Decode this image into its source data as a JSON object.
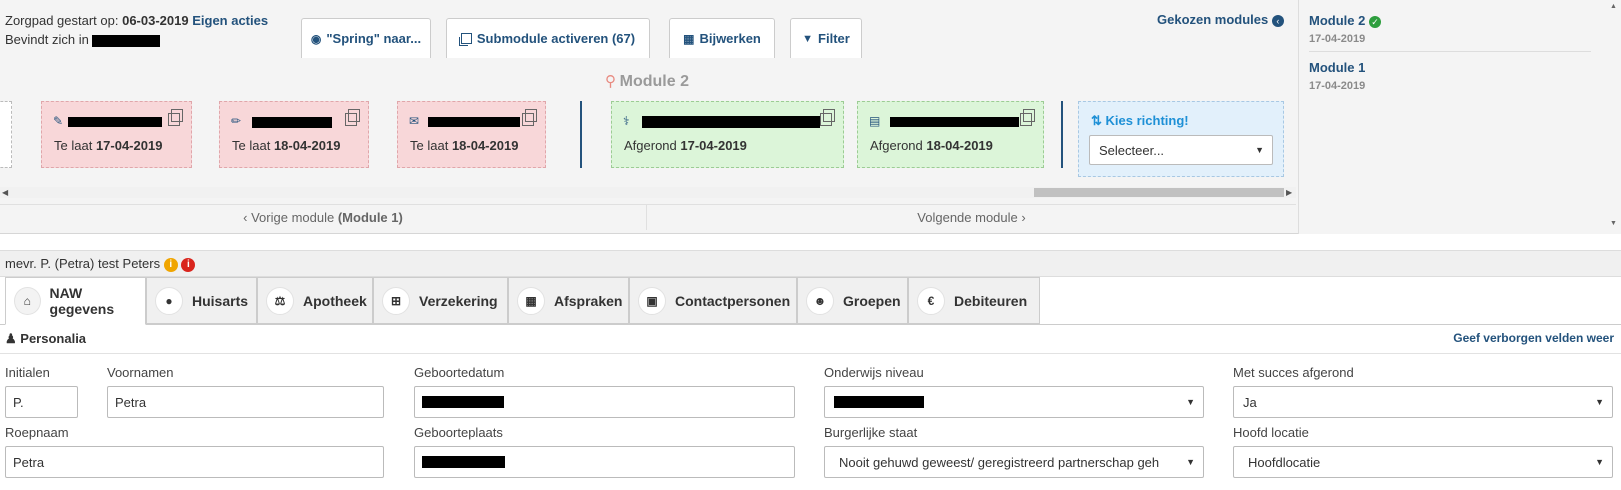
{
  "pathway": {
    "started_label": "Zorgpad gestart op:",
    "started_date": "06-03-2019",
    "own_actions": "Eigen acties",
    "located_in": "Bevindt zich in"
  },
  "toolbar": {
    "jump_label": "\"Spring\" naar...",
    "activate_label": "Submodule activeren (67)",
    "update_label": "Bijwerken",
    "filter_label": "Filter",
    "chosen_modules_label": "Gekozen modules"
  },
  "module": {
    "title": "Module 2",
    "cards": [
      {
        "status": "Te laat",
        "date": "17-04-2019",
        "icon": "edit-square-icon"
      },
      {
        "status": "Te laat",
        "date": "18-04-2019",
        "icon": "pencil-icon"
      },
      {
        "status": "Te laat",
        "date": "18-04-2019",
        "icon": "envelope-icon"
      },
      {
        "status": "Afgerond",
        "date": "17-04-2019",
        "icon": "stethoscope-icon"
      },
      {
        "status": "Afgerond",
        "date": "18-04-2019",
        "icon": "calendar-icon"
      }
    ],
    "direction": {
      "label": "Kies richting!",
      "select_value": "Selecteer..."
    },
    "prev_label": "Vorige module",
    "prev_name": "(Module 1)",
    "next_label": "Volgende module"
  },
  "sidebar": {
    "items": [
      {
        "name": "Module 2",
        "date": "17-04-2019"
      },
      {
        "name": "Module 1",
        "date": "17-04-2019"
      }
    ]
  },
  "patient": {
    "name": "mevr. P. (Petra) test Peters"
  },
  "tabs": [
    {
      "label": "NAW gegevens",
      "icon": "home-icon"
    },
    {
      "label": "Huisarts",
      "icon": "doctor-icon"
    },
    {
      "label": "Apotheek",
      "icon": "scale-icon"
    },
    {
      "label": "Verzekering",
      "icon": "plus-square-icon"
    },
    {
      "label": "Afspraken",
      "icon": "calendar-icon"
    },
    {
      "label": "Contactpersonen",
      "icon": "address-book-icon"
    },
    {
      "label": "Groepen",
      "icon": "group-icon"
    },
    {
      "label": "Debiteuren",
      "icon": "euro-icon"
    }
  ],
  "personalia": {
    "title": "Personalia",
    "show_hidden": "Geef verborgen velden weer",
    "initials_label": "Initialen",
    "initials_value": "P.",
    "firstnames_label": "Voornamen",
    "firstnames_value": "Petra",
    "birthdate_label": "Geboortedatum",
    "education_label": "Onderwijs niveau",
    "success_label": "Met succes afgerond",
    "success_value": "Ja",
    "callname_label": "Roepnaam",
    "callname_value": "Petra",
    "birthplace_label": "Geboorteplaats",
    "civil_label": "Burgerlijke staat",
    "civil_value": "Nooit gehuwd geweest/ geregistreerd partnerschap geh",
    "location_label": "Hoofd locatie",
    "location_value": "Hoofdlocatie"
  },
  "colors": {
    "link": "#23527c",
    "late": "#f8d7d9",
    "done": "#dcf5d9",
    "info_badge": "#f0a500",
    "alert_badge": "#d9251d"
  }
}
